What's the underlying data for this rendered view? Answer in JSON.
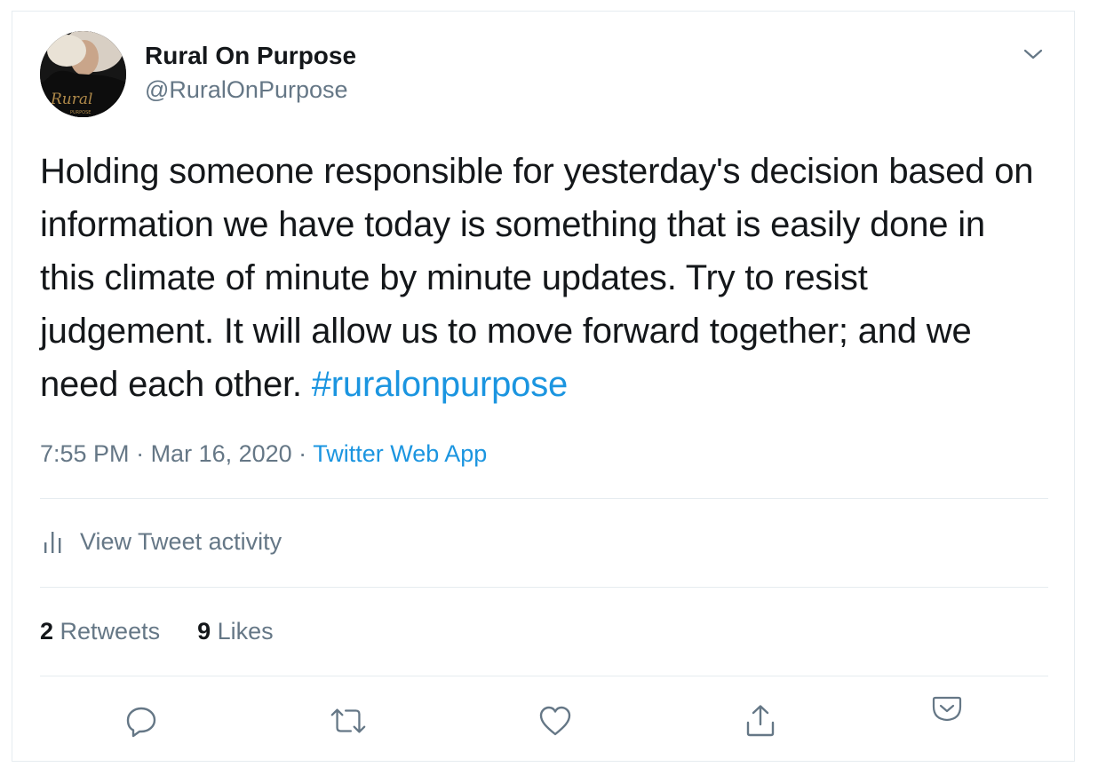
{
  "author": {
    "display_name": "Rural On Purpose",
    "handle": "@RuralOnPurpose",
    "avatar_text": "Rural",
    "avatar_subtext": "PURPOSE"
  },
  "tweet": {
    "text": "Holding someone responsible for yesterday's decision based on information we have today is something that is easily done in this climate of minute by minute updates. Try to resist judgement. It will allow us to move forward together; and we need each other. ",
    "hashtag": "#ruralonpurpose"
  },
  "meta": {
    "time": "7:55 PM",
    "separator": " · ",
    "date": "Mar 16, 2020",
    "source": "Twitter Web App"
  },
  "activity": {
    "label": "View Tweet activity"
  },
  "stats": {
    "retweets_count": "2",
    "retweets_label": "Retweets",
    "likes_count": "9",
    "likes_label": "Likes"
  },
  "colors": {
    "link": "#1b95e0",
    "secondary_text": "#657786",
    "primary_text": "#14171a",
    "border": "#e6ecf0"
  },
  "icons": {
    "caret": "chevron-down-icon",
    "activity": "bar-chart-icon",
    "reply": "reply-icon",
    "retweet": "retweet-icon",
    "like": "heart-icon",
    "share": "share-icon",
    "pocket": "pocket-icon"
  }
}
